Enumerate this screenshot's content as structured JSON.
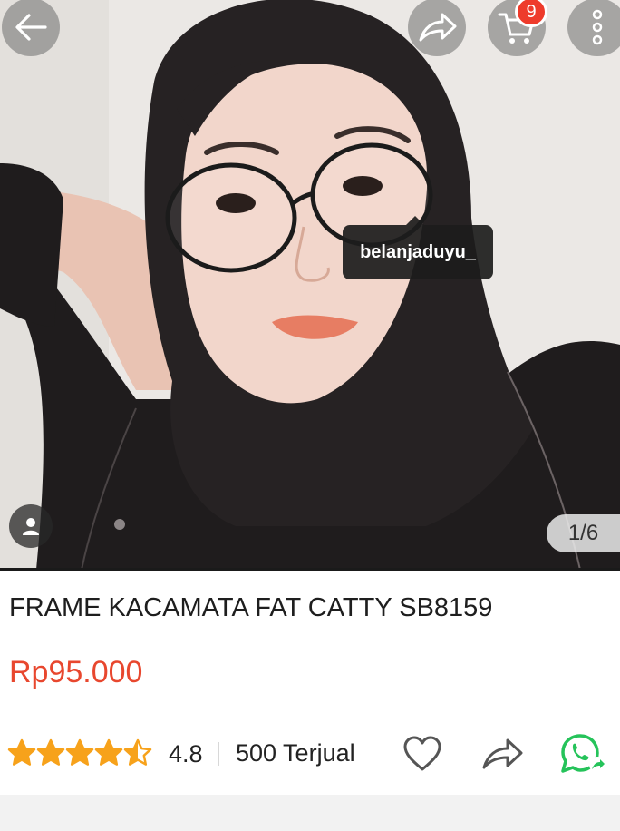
{
  "product": {
    "title": "FRAME KACAMATA FAT CATTY SB8159",
    "price": "Rp95.000",
    "rating": "4.8",
    "rating_value": 4.5,
    "rating_max": 5,
    "sold": "500 Terjual"
  },
  "gallery": {
    "counter": "1/6",
    "user_tag": "belanjaduyu_"
  },
  "header": {
    "cart_count": "9"
  },
  "colors": {
    "price": "#e8472e",
    "star": "#f7a21b",
    "badge": "#ee3b2b",
    "whatsapp": "#25c35a"
  },
  "icons": {
    "back": "arrow-left-icon",
    "share": "share-icon",
    "cart": "cart-icon",
    "more": "more-vertical-icon",
    "person": "person-icon",
    "wishlist": "heart-icon",
    "share_inline": "share-icon",
    "whatsapp": "whatsapp-icon"
  }
}
